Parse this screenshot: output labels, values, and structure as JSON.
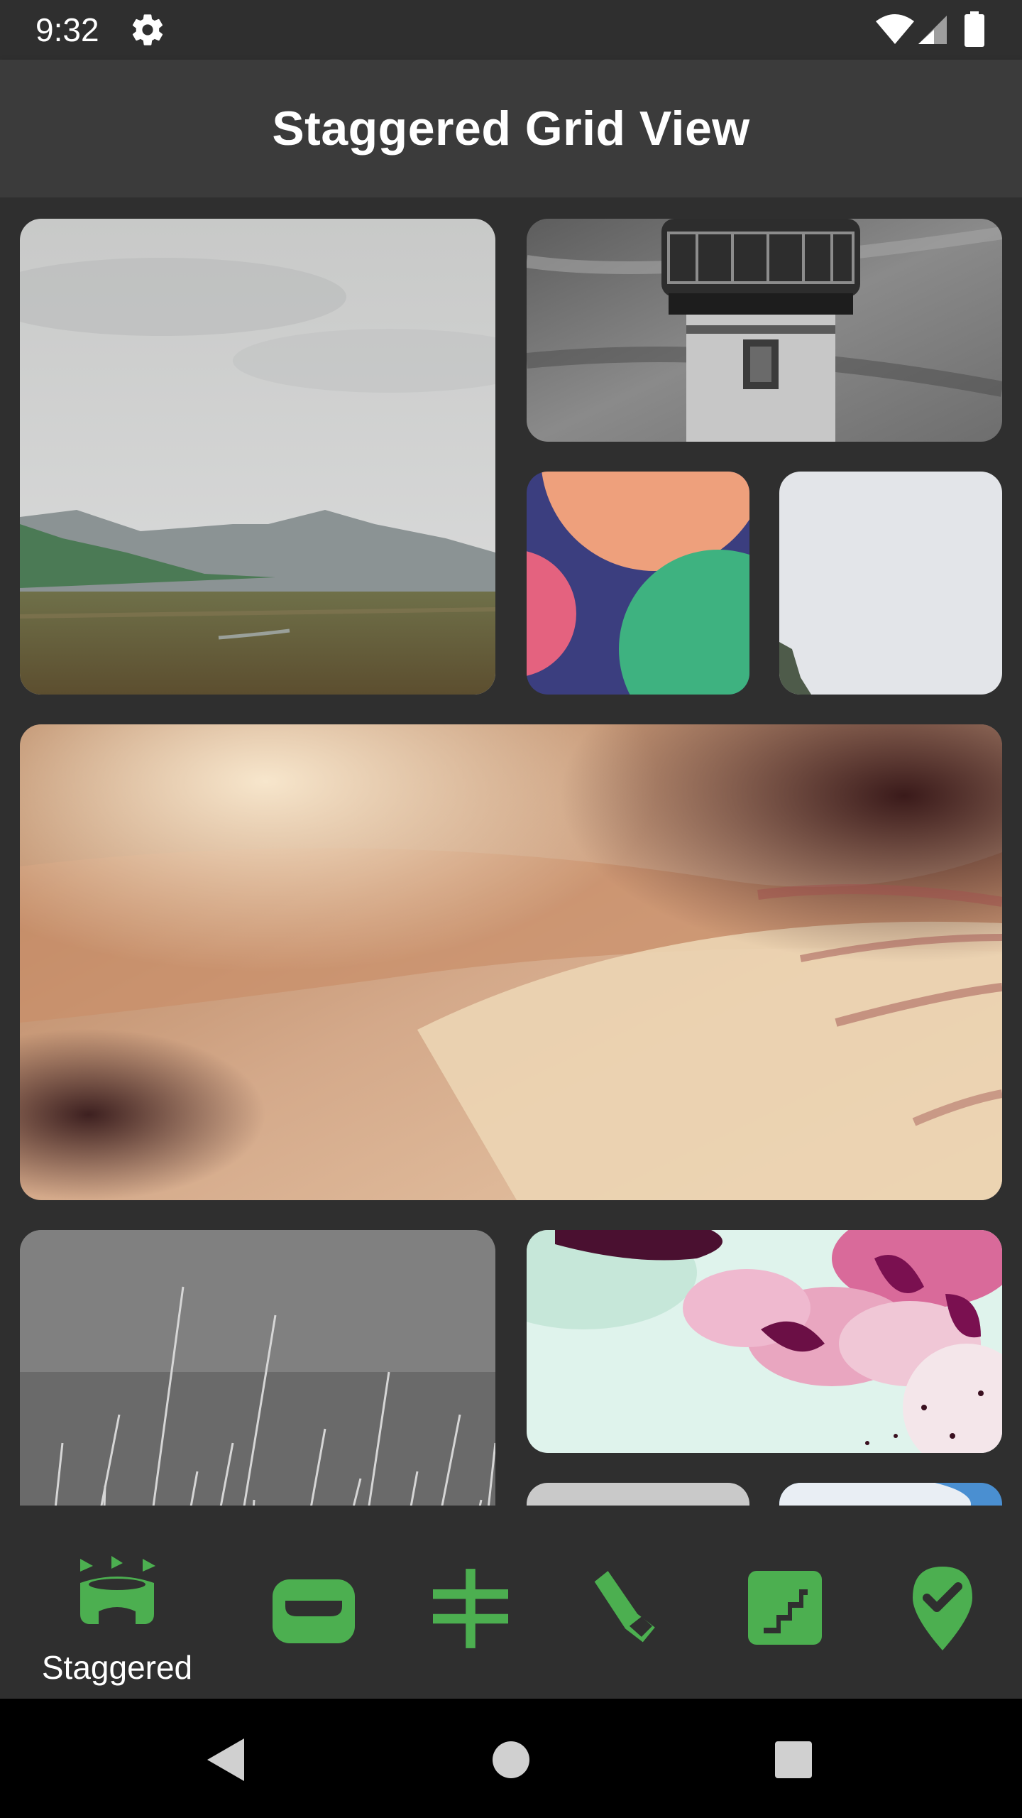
{
  "status_bar": {
    "time": "9:32",
    "icons": [
      "gear-icon",
      "wifi-icon",
      "signal-icon",
      "battery-icon"
    ]
  },
  "app_bar": {
    "title": "Staggered Grid View"
  },
  "grid": {
    "images": [
      {
        "subject": "cloudy-valley-landscape"
      },
      {
        "subject": "lighthouse-black-white"
      },
      {
        "subject": "colorful-bokeh-circles"
      },
      {
        "subject": "pale-sky-with-tree"
      },
      {
        "subject": "blurry-skin-closeup"
      },
      {
        "subject": "grass-black-white"
      },
      {
        "subject": "pink-flowers-blurred"
      },
      {
        "subject": "grey-partial-image"
      },
      {
        "subject": "blue-sky-partial-image"
      }
    ]
  },
  "bottom_nav": {
    "accent_color": "#4caf50",
    "items": [
      {
        "icon": "stadium-icon",
        "label": "Staggered",
        "selected": true
      },
      {
        "icon": "wallet-icon",
        "label": "",
        "selected": false
      },
      {
        "icon": "tally-plus-icon",
        "label": "",
        "selected": false
      },
      {
        "icon": "flashlight-icon",
        "label": "",
        "selected": false
      },
      {
        "icon": "stairs-icon",
        "label": "",
        "selected": false
      },
      {
        "icon": "location-check-icon",
        "label": "",
        "selected": false
      }
    ]
  },
  "system_nav": {
    "buttons": [
      "back-icon",
      "home-icon",
      "recents-icon"
    ]
  }
}
